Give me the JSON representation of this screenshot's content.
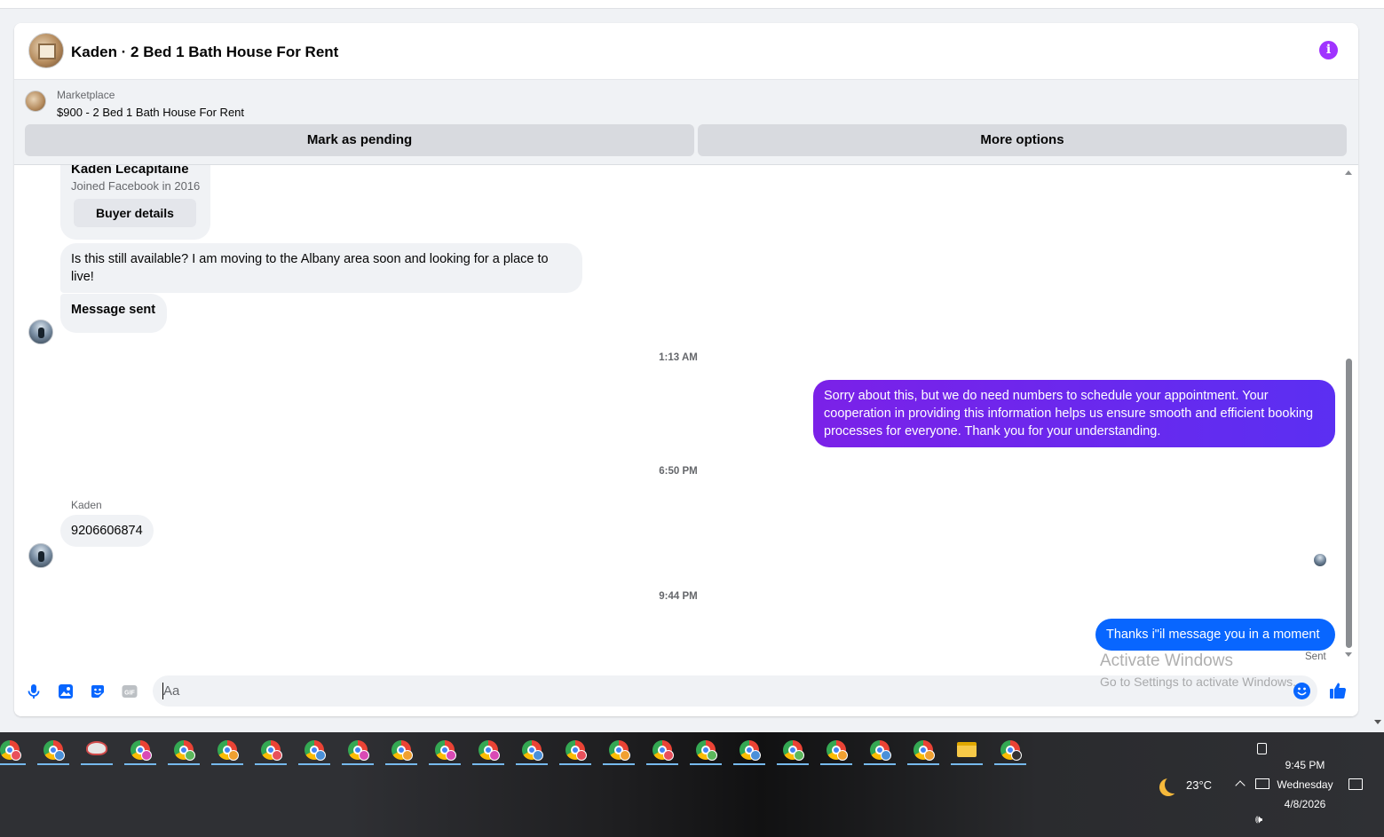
{
  "header": {
    "title": "Kaden · 2 Bed 1 Bath House For Rent",
    "info_icon": "i"
  },
  "listing": {
    "source": "Marketplace",
    "title": "$900 - 2 Bed 1 Bath House For Rent",
    "mark_pending_label": "Mark as pending",
    "more_options_label": "More options"
  },
  "buyer_card": {
    "name": "Kaden Lecapitaine",
    "joined": "Joined Facebook in 2016",
    "details_label": "Buyer details"
  },
  "messages": [
    {
      "from": "buyer",
      "text": "Is this still available? I am moving to the Albany area soon and looking for a place to live!"
    },
    {
      "from": "buyer",
      "text": "Message sent"
    },
    {
      "timestamp": "1:13 AM"
    },
    {
      "from": "me",
      "text": "Sorry about this, but we do need numbers to schedule your appointment. Your cooperation in providing this information helps us ensure smooth and efficient booking processes for everyone. Thank you for your understanding."
    },
    {
      "timestamp": "6:50 PM"
    },
    {
      "sender_name": "Kaden",
      "from": "buyer",
      "text": "9206606874"
    },
    {
      "timestamp": "9:44 PM"
    },
    {
      "from": "me",
      "text": "Thanks i\"il message you in a moment",
      "status": "Sent"
    }
  ],
  "composer": {
    "placeholder": "Aa",
    "icons": [
      "microphone-icon",
      "photo-icon",
      "sticker-icon",
      "gif-icon",
      "emoji-icon",
      "thumbs-up-icon"
    ],
    "gif_label": "GIF"
  },
  "watermark": {
    "title": "Activate Windows",
    "subtitle": "Go to Settings to activate Windows."
  },
  "colors": {
    "outgoing_gradient_start": "#7b21e8",
    "outgoing_gradient_end": "#5b2ff2",
    "outgoing_blue": "#0866ff",
    "accent_purple": "#a033ff",
    "incoming_bg": "#f0f2f5"
  },
  "taskbar": {
    "apps": [
      {
        "icon": "chrome-icon",
        "badge": "#e8505b"
      },
      {
        "icon": "chrome-icon",
        "badge": "#4a90d9"
      },
      {
        "icon": "paint-icon",
        "badge": ""
      },
      {
        "icon": "chrome-icon",
        "badge": "#d94ab5"
      },
      {
        "icon": "chrome-icon",
        "badge": "#5cb85c"
      },
      {
        "icon": "chrome-icon",
        "badge": "#f0a030"
      },
      {
        "icon": "chrome-icon",
        "badge": "#e8505b"
      },
      {
        "icon": "chrome-icon",
        "badge": "#4a90d9"
      },
      {
        "icon": "chrome-icon",
        "badge": "#d94ab5"
      },
      {
        "icon": "chrome-icon",
        "badge": "#f0a030"
      },
      {
        "icon": "chrome-icon",
        "badge": "#d94ab5"
      },
      {
        "icon": "chrome-icon",
        "badge": "#d94ab5"
      },
      {
        "icon": "chrome-icon",
        "badge": "#4a90d9"
      },
      {
        "icon": "chrome-icon",
        "badge": "#e8505b"
      },
      {
        "icon": "chrome-icon",
        "badge": "#f0a030"
      },
      {
        "icon": "chrome-icon",
        "badge": "#e8505b"
      },
      {
        "icon": "chrome-icon",
        "badge": "#5cb85c"
      },
      {
        "icon": "chrome-icon",
        "badge": "#4a90d9"
      },
      {
        "icon": "chrome-icon",
        "badge": "#5cb85c"
      },
      {
        "icon": "chrome-icon",
        "badge": "#f0a030"
      },
      {
        "icon": "chrome-icon",
        "badge": "#4a90d9"
      },
      {
        "icon": "chrome-icon",
        "badge": "#f0a030"
      },
      {
        "icon": "folder-icon",
        "badge": ""
      },
      {
        "icon": "chrome-icon",
        "badge": "#333333"
      }
    ],
    "weather": {
      "icon": "moon-icon",
      "temp": "23°C"
    },
    "clock": {
      "time": "9:45 PM",
      "day": "Wednesday",
      "date": "4/8/2026"
    }
  }
}
